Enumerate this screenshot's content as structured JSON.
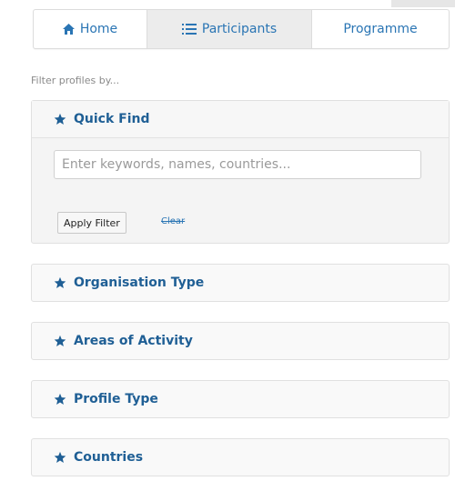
{
  "nav": {
    "tabs": [
      {
        "label": "Home",
        "icon": "home-icon"
      },
      {
        "label": "Participants",
        "icon": "list-icon"
      },
      {
        "label": "Programme"
      }
    ],
    "active_tab": "Participants"
  },
  "filter": {
    "label": "Filter profiles by...",
    "quick_find": {
      "title": "Quick Find",
      "search_placeholder": "Enter keywords, names, countries...",
      "apply_label": "Apply Filter",
      "clear_label": "Clear"
    },
    "sections": [
      {
        "title": "Organisation Type"
      },
      {
        "title": "Areas of Activity"
      },
      {
        "title": "Profile Type"
      },
      {
        "title": "Countries"
      }
    ]
  },
  "colors": {
    "link": "#2a75b4",
    "heading": "#1f5f95",
    "active_tab_bg": "#ececec",
    "panel_bg": "#f9f9f9"
  }
}
